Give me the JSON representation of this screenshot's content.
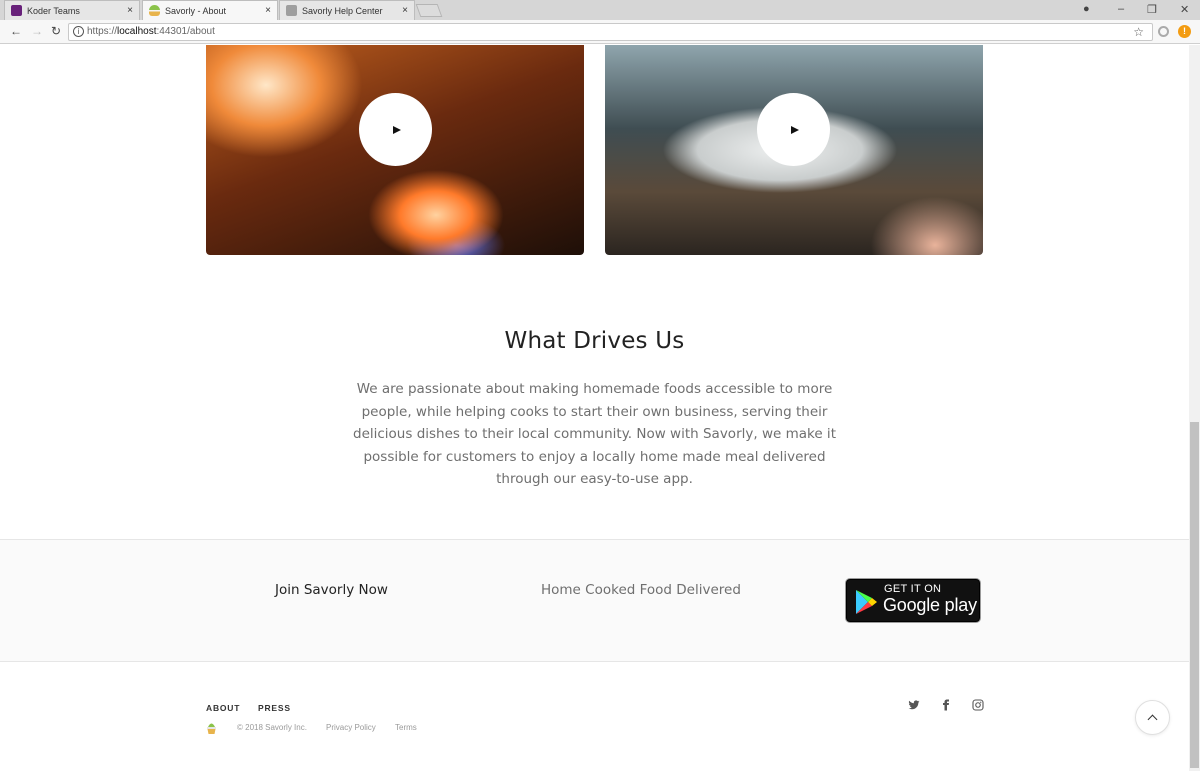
{
  "browser": {
    "tabs": [
      {
        "title": "Koder Teams",
        "active": false,
        "icon": "koder-teams-icon"
      },
      {
        "title": "Savorly - About",
        "active": true,
        "icon": "savorly-icon"
      },
      {
        "title": "Savorly Help Center",
        "active": false,
        "icon": "help-center-icon"
      }
    ],
    "url": {
      "scheme": "https://",
      "host": "localhost",
      "rest": ":44301/about"
    },
    "tab_close_glyph": "×"
  },
  "videos": [
    {
      "name": "fire-pan-video",
      "play_icon": "play-icon"
    },
    {
      "name": "plated-dish-video",
      "play_icon": "play-icon"
    }
  ],
  "mission": {
    "title": "What Drives Us",
    "body": "We are passionate about making homemade foods accessible to more people, while helping cooks to start their own business, serving their delicious dishes to their local community. Now with Savorly, we make it possible for customers to enjoy a locally home made meal delivered through our easy-to-use app."
  },
  "join": {
    "cta": "Join Savorly Now",
    "tagline": "Home Cooked Food Delivered",
    "store_badge": {
      "small": "GET IT ON",
      "big": "Google play"
    }
  },
  "footer": {
    "nav": [
      "ABOUT",
      "PRESS"
    ],
    "copyright": "© 2018 Savorly Inc.",
    "links": [
      "Privacy Policy",
      "Terms"
    ],
    "social": [
      "twitter-icon",
      "facebook-icon",
      "instagram-icon"
    ]
  },
  "colors": {
    "accent": "#f39c12",
    "brand_green": "#8bc34a"
  }
}
